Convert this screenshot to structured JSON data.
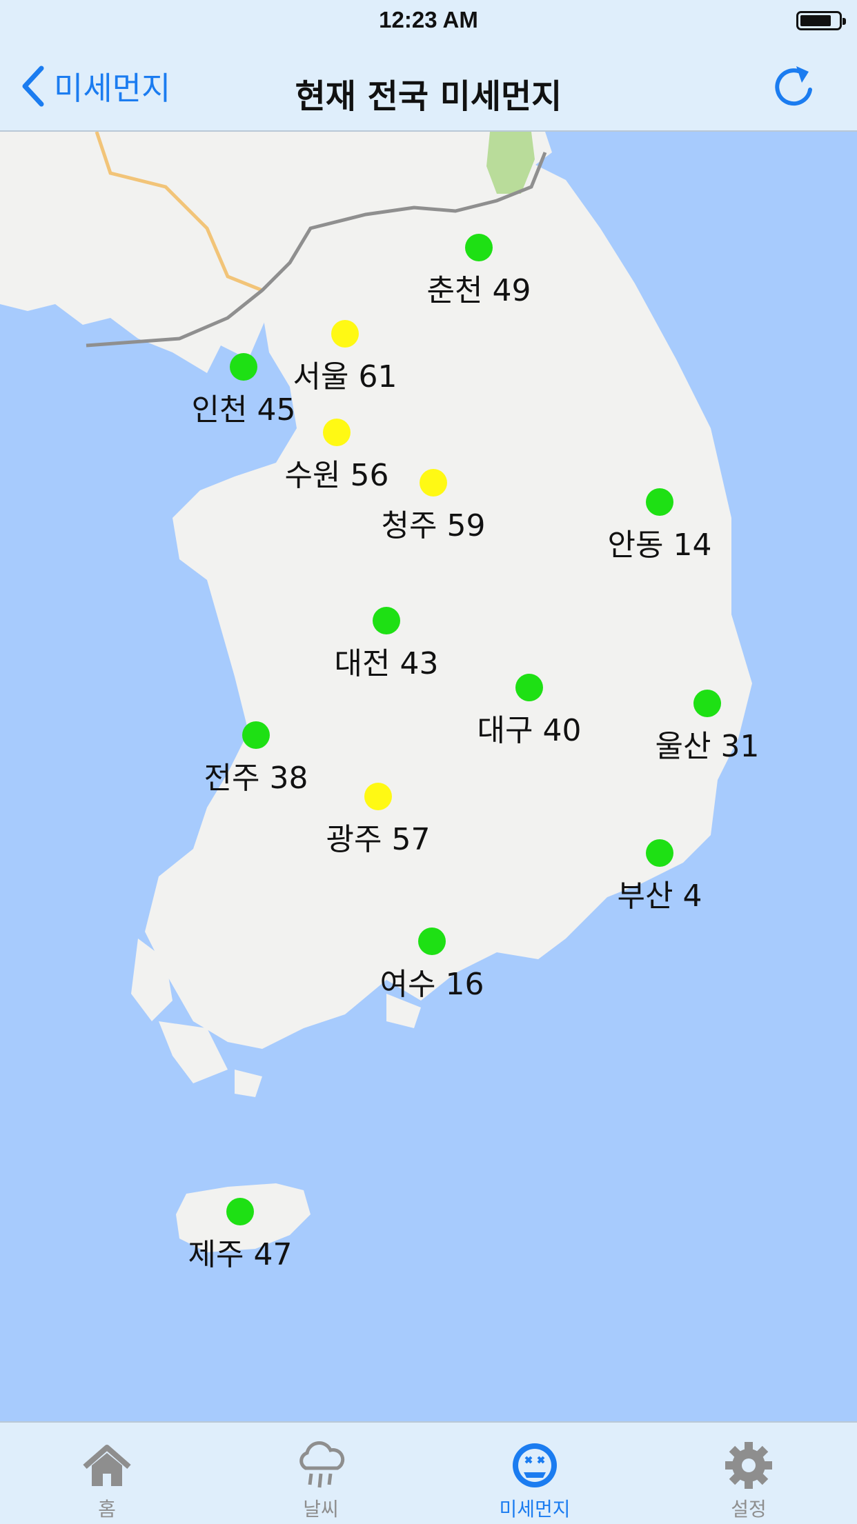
{
  "status_bar": {
    "time": "12:23 AM"
  },
  "nav": {
    "back_label": "미세먼지",
    "title": "현재 전국 미세먼지"
  },
  "colors": {
    "good": "#1ee014",
    "moderate": "#fff914",
    "accent": "#1b7cf0",
    "sea": "#a7cbfd",
    "land": "#f2f2f0"
  },
  "map": {
    "markers": [
      {
        "city": "춘천",
        "value": "49",
        "level": "good",
        "label": "춘천 49"
      },
      {
        "city": "서울",
        "value": "61",
        "level": "moderate",
        "label": "서울 61"
      },
      {
        "city": "인천",
        "value": "45",
        "level": "good",
        "label": "인천 45"
      },
      {
        "city": "수원",
        "value": "56",
        "level": "moderate",
        "label": "수원 56"
      },
      {
        "city": "청주",
        "value": "59",
        "level": "moderate",
        "label": "청주 59"
      },
      {
        "city": "안동",
        "value": "14",
        "level": "good",
        "label": "안동 14"
      },
      {
        "city": "대전",
        "value": "43",
        "level": "good",
        "label": "대전 43"
      },
      {
        "city": "대구",
        "value": "40",
        "level": "good",
        "label": "대구 40"
      },
      {
        "city": "울산",
        "value": "31",
        "level": "good",
        "label": "울산 31"
      },
      {
        "city": "전주",
        "value": "38",
        "level": "good",
        "label": "전주 38"
      },
      {
        "city": "광주",
        "value": "57",
        "level": "moderate",
        "label": "광주 57"
      },
      {
        "city": "부산",
        "value": "4",
        "level": "good",
        "label": "부산 4"
      },
      {
        "city": "여수",
        "value": "16",
        "level": "good",
        "label": "여수 16"
      },
      {
        "city": "제주",
        "value": "47",
        "level": "good",
        "label": "제주 47"
      }
    ]
  },
  "tabs": [
    {
      "label": "홈",
      "icon": "home-icon",
      "active": false
    },
    {
      "label": "날씨",
      "icon": "weather-icon",
      "active": false
    },
    {
      "label": "미세먼지",
      "icon": "dust-icon",
      "active": true
    },
    {
      "label": "설정",
      "icon": "gear-icon",
      "active": false
    }
  ]
}
